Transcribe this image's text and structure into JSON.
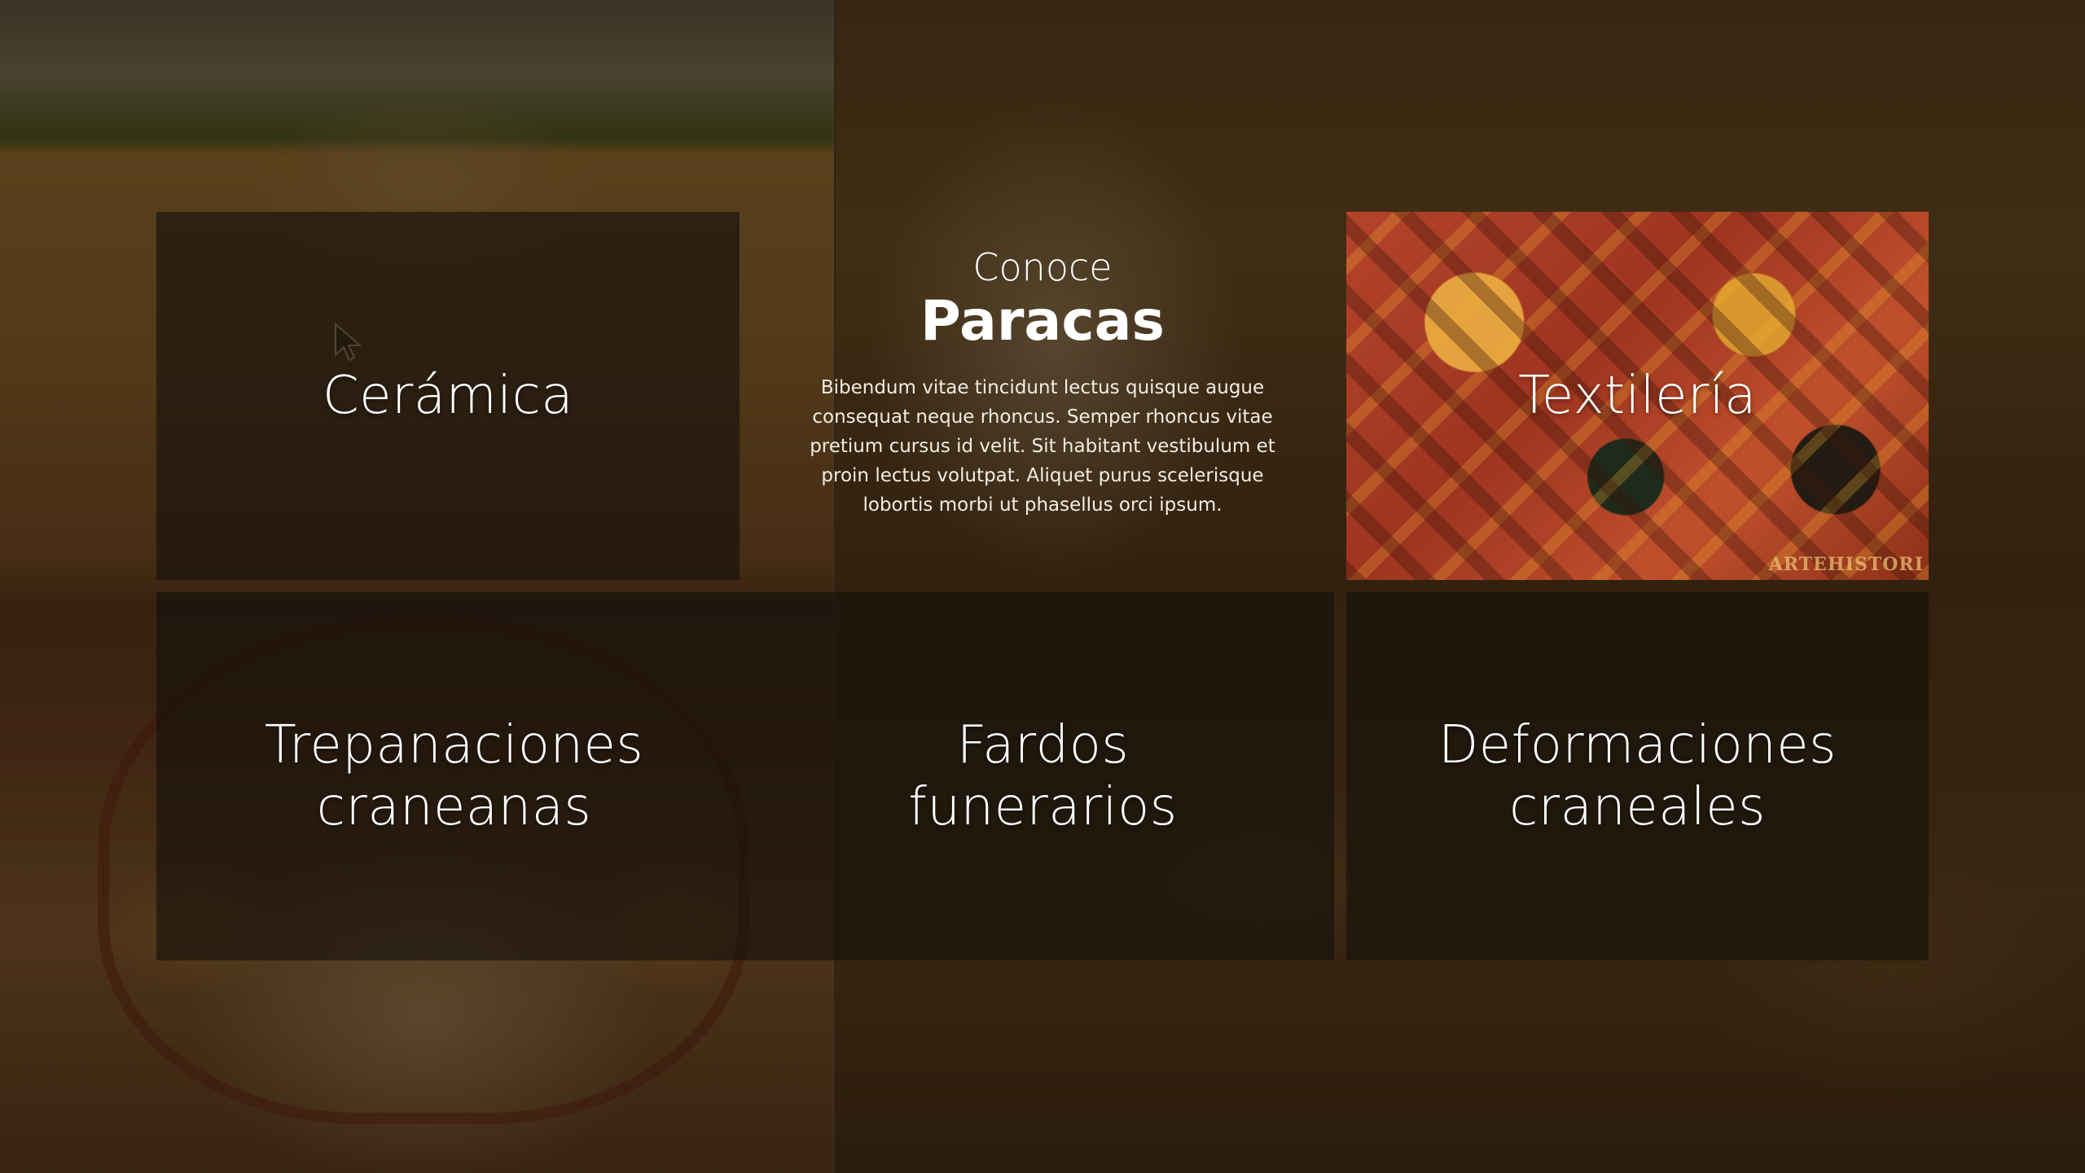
{
  "intro": {
    "kicker": "Conoce",
    "title": "Paracas",
    "body": "Bibendum vitae tincidunt lectus quisque augue consequat neque rhoncus. Semper rhoncus vitae pretium cursus id velit. Sit habitant vestibulum et proin lectus volutpat. Aliquet purus scelerisque lobortis morbi ut phasellus orci ipsum."
  },
  "tiles": [
    {
      "label": "Cerámica"
    },
    {
      "label": "Textilería",
      "watermark": "ARTEHISTORI"
    },
    {
      "label": "Trepanaciones craneanas"
    },
    {
      "label": "Fardos funerarios"
    },
    {
      "label": "Deformaciones craneales"
    }
  ]
}
